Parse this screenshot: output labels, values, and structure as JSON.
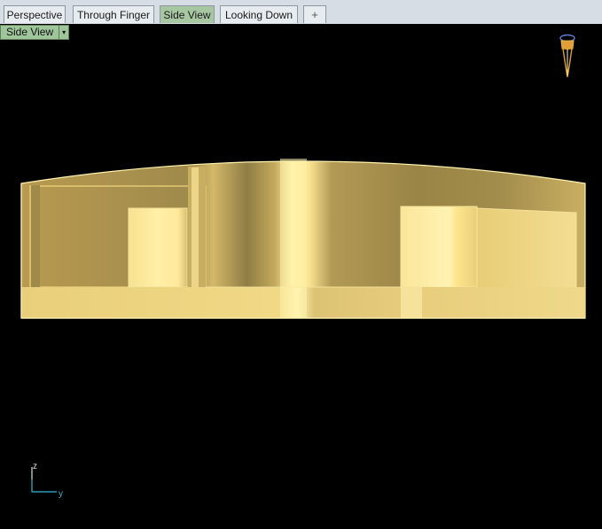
{
  "tabs": [
    {
      "label": "Perspective",
      "active": false
    },
    {
      "label": "Through Finger",
      "active": false
    },
    {
      "label": "Side View",
      "active": true
    },
    {
      "label": "Looking Down",
      "active": false
    }
  ],
  "add_tab_icon": "+",
  "viewport": {
    "label": "Side View",
    "dropdown_icon": "▾"
  },
  "axes": {
    "z_label": "z",
    "y_label": "y"
  },
  "colors": {
    "active_tab": "#a6c7a1",
    "gold_light": "#fff0a6",
    "gold_mid": "#e8cd78",
    "gold_dark": "#9a8446"
  }
}
